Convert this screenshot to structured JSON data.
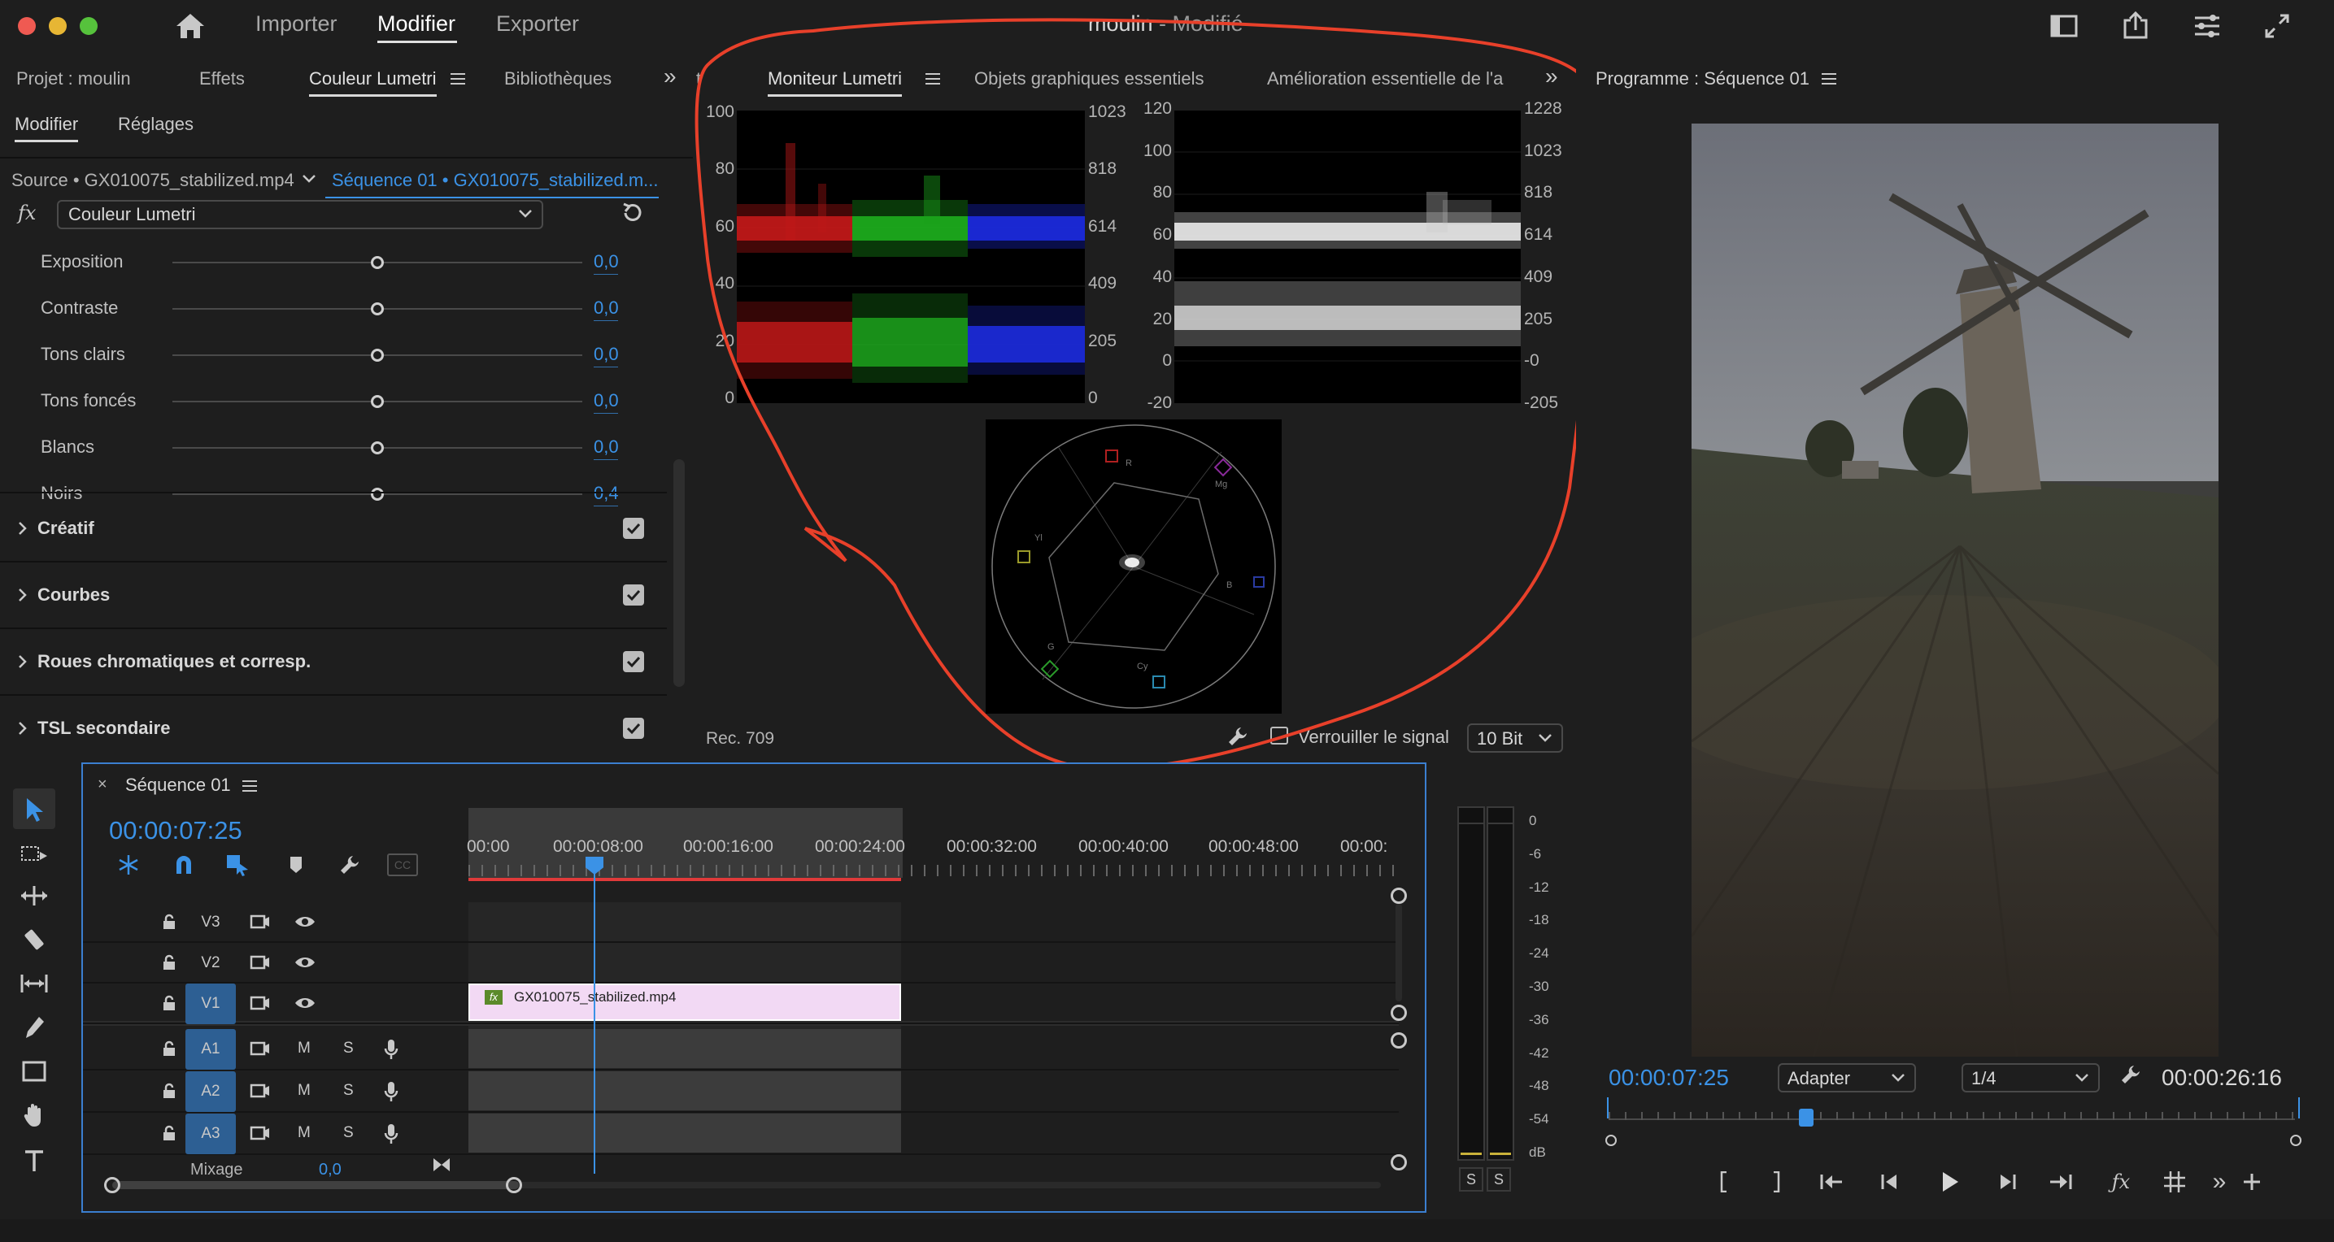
{
  "topbar": {
    "nav_import": "Importer",
    "nav_edit": "Modifier",
    "nav_export": "Exporter",
    "project_name": "moulin",
    "project_state": " - Modifié"
  },
  "left_tabs": [
    "Projet : moulin",
    "Effets",
    "Couleur Lumetri",
    "Bibliothèques"
  ],
  "left_tabs_more": "»",
  "lumetri": {
    "subtab_modify": "Modifier",
    "subtab_settings": "Réglages",
    "source": "Source • GX010075_stabilized.mp4",
    "sequence": "Séquence 01 • GX010075_stabilized.m...",
    "fx": "fx",
    "effect": "Couleur Lumetri",
    "params": [
      {
        "label": "Exposition",
        "value": "0,0",
        "knob": 0.5
      },
      {
        "label": "Contraste",
        "value": "0,0",
        "knob": 0.5
      },
      {
        "label": "Tons clairs",
        "value": "0,0",
        "knob": 0.5
      },
      {
        "label": "Tons foncés",
        "value": "0,0",
        "knob": 0.5
      },
      {
        "label": "Blancs",
        "value": "0,0",
        "knob": 0.5
      },
      {
        "label": "Noirs",
        "value": "0,4",
        "knob": 0.5
      }
    ],
    "sections": [
      "Créatif",
      "Courbes",
      "Roues chromatiques et corresp.",
      "TSL secondaire"
    ]
  },
  "monitor_tabs": {
    "prefix": "t",
    "lumetri_monitor": "Moniteur Lumetri",
    "essential_graphics": "Objets graphiques essentiels",
    "essential_sound": "Amélioration essentielle de l'a",
    "more": "»"
  },
  "scopes": {
    "parade_left_ticks": [
      "100",
      "80",
      "60",
      "40",
      "20",
      "0"
    ],
    "parade_right_ticks": [
      "1023",
      "818",
      "614",
      "409",
      "205",
      "0"
    ],
    "wave_left_ticks": [
      "120",
      "100",
      "80",
      "60",
      "40",
      "20",
      "0",
      "-20"
    ],
    "wave_right_ticks": [
      "1228",
      "1023",
      "818",
      "614",
      "409",
      "205",
      "-0",
      "-205"
    ],
    "vector_labels": [
      "R",
      "Mg",
      "B",
      "Cy",
      "G",
      "Yl"
    ],
    "colorspace": "Rec. 709",
    "lock_signal": "Verrouiller le signal",
    "bit_depth": "10 Bit"
  },
  "program": {
    "title": "Programme : Séquence 01",
    "timecode": "00:00:07:25",
    "fit": "Adapter",
    "resolution": "1/4",
    "duration": "00:00:26:16"
  },
  "timeline": {
    "sequence_name": "Séquence 01",
    "timecode": "00:00:07:25",
    "ruler": [
      "00:00",
      "00:00:08:00",
      "00:00:16:00",
      "00:00:24:00",
      "00:00:32:00",
      "00:00:40:00",
      "00:00:48:00",
      "00:00:"
    ],
    "video_tracks": [
      "V3",
      "V2",
      "V1"
    ],
    "audio_tracks": [
      "A1",
      "A2",
      "A3"
    ],
    "clip_name": "GX010075_stabilized.mp4",
    "clip_fx": "fx",
    "mute": "M",
    "solo": "S",
    "mix_label": "Mixage",
    "mix_value": "0,0",
    "cc": "CC"
  },
  "meter": {
    "ticks": [
      "0",
      "-6",
      "-12",
      "-18",
      "-24",
      "-30",
      "-36",
      "-42",
      "-48",
      "-54",
      "dB"
    ],
    "solo_left": "S",
    "solo_right": "S"
  },
  "colors": {
    "accent_blue": "#3b92e6",
    "annotation_red": "#e8402a",
    "clip_pink": "#f2d9f4",
    "playhead_red": "#e03a3a"
  }
}
